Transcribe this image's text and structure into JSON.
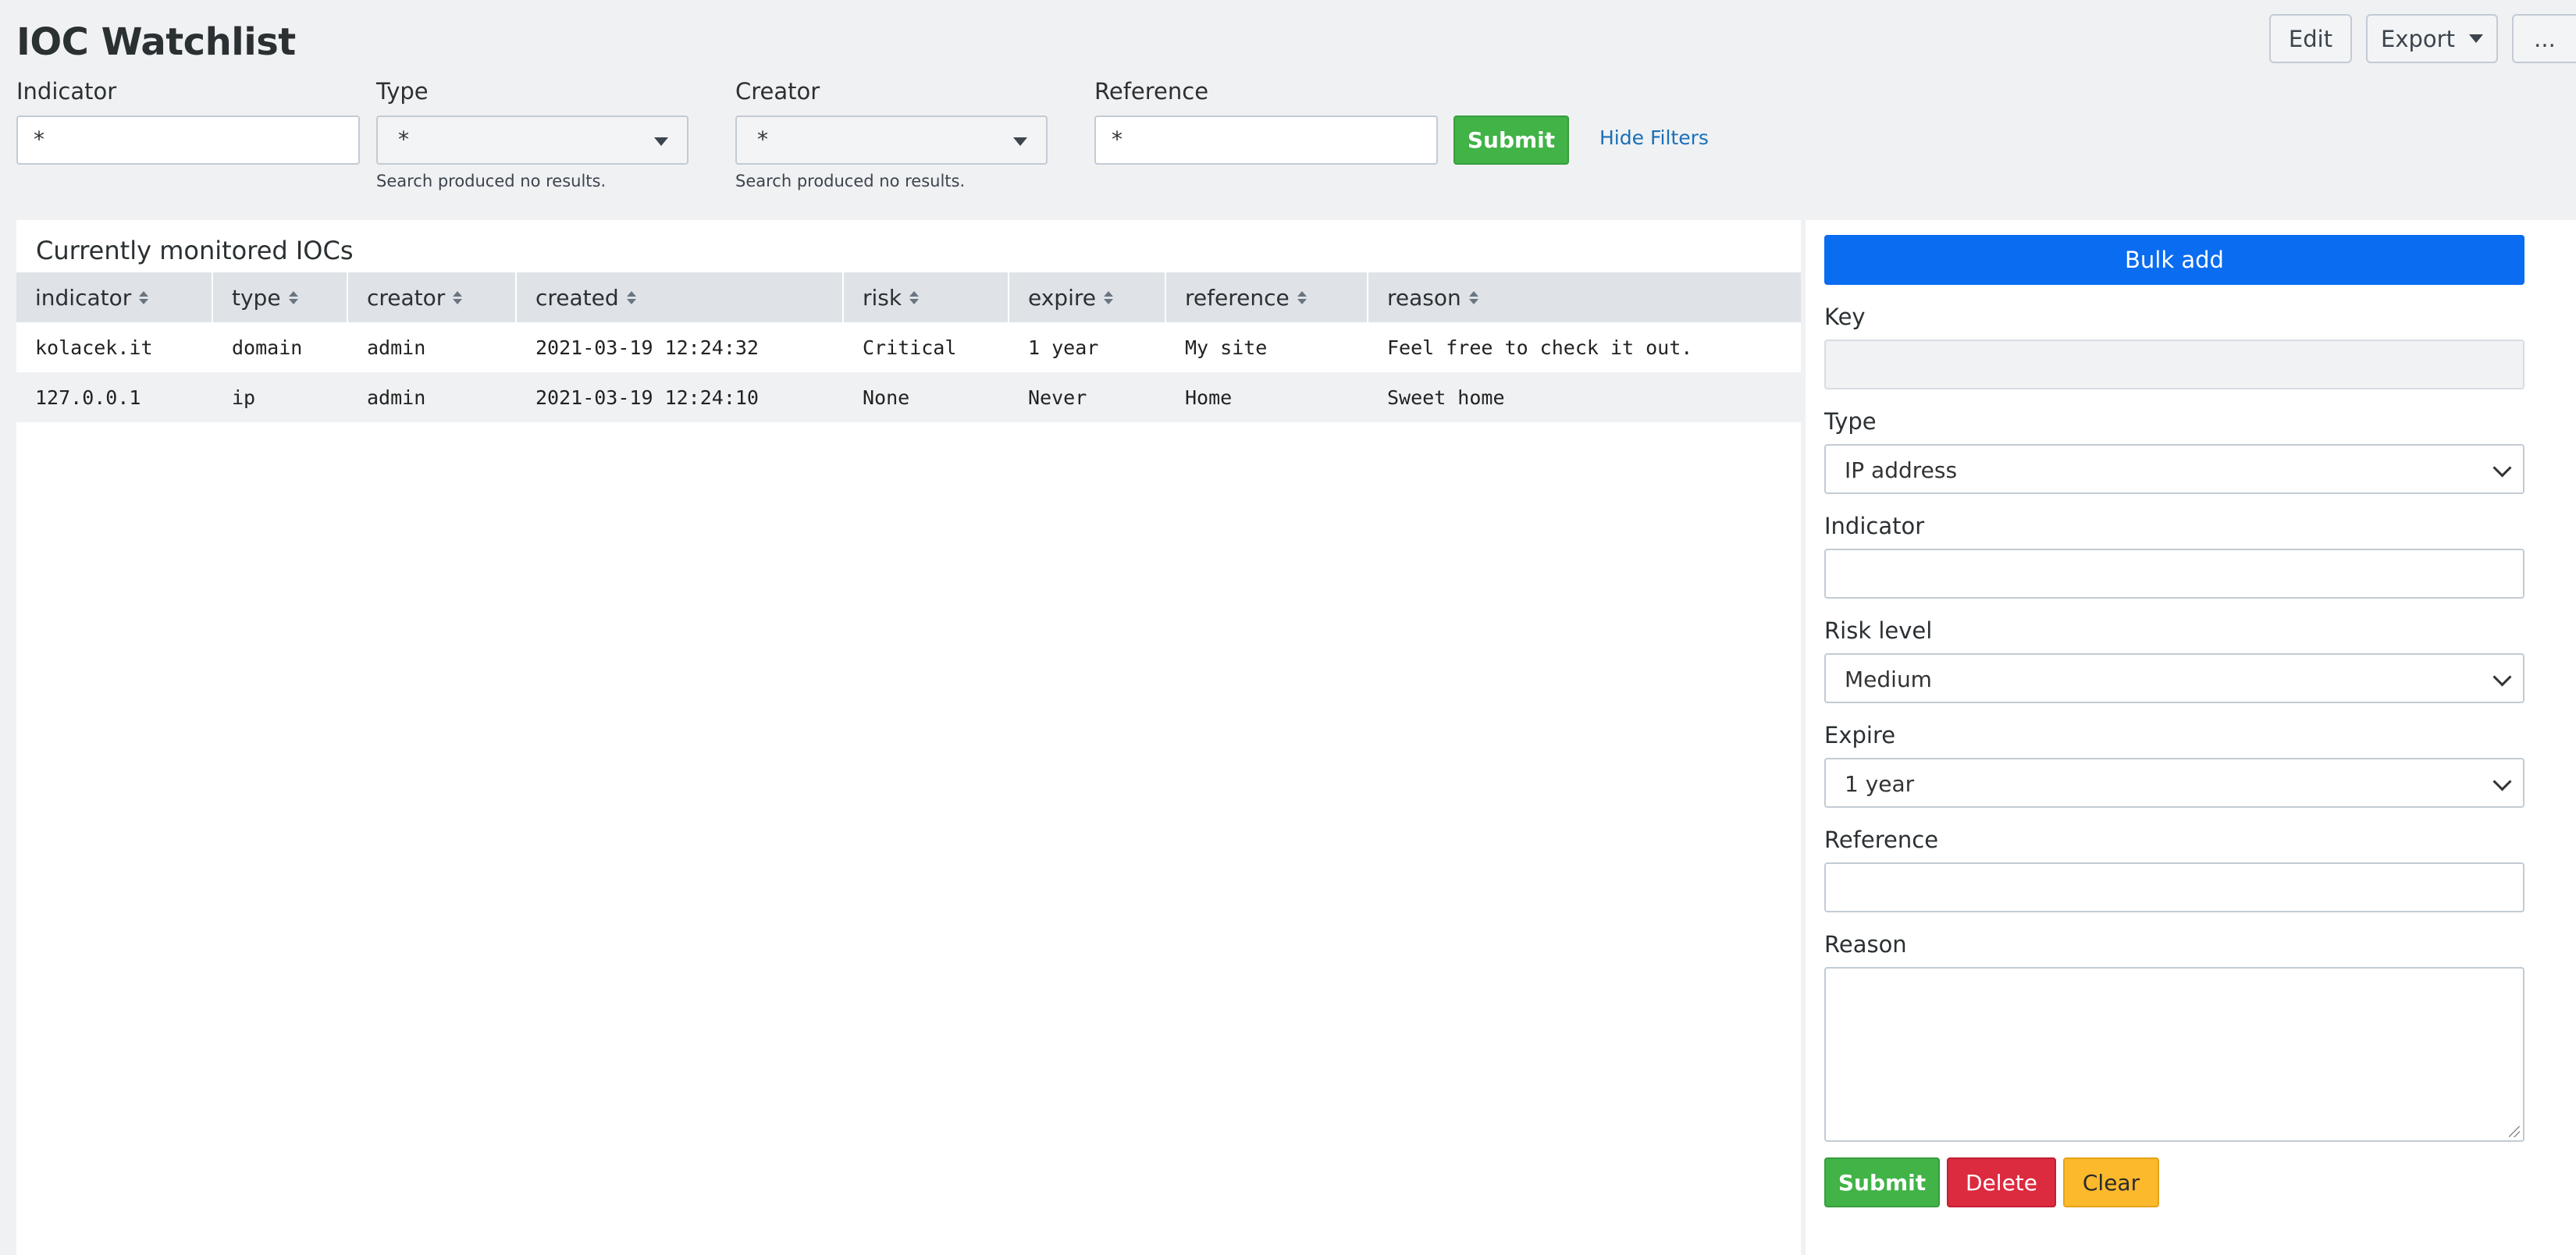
{
  "header": {
    "title": "IOC Watchlist",
    "buttons": {
      "edit": "Edit",
      "export": "Export",
      "more": "..."
    }
  },
  "filters": {
    "indicator": {
      "label": "Indicator",
      "value": "*"
    },
    "type": {
      "label": "Type",
      "value": "*",
      "hint": "Search produced no results."
    },
    "creator": {
      "label": "Creator",
      "value": "*",
      "hint": "Search produced no results."
    },
    "reference": {
      "label": "Reference",
      "value": "*"
    },
    "submit": "Submit",
    "hide_filters": "Hide Filters"
  },
  "table": {
    "title": "Currently monitored IOCs",
    "columns": [
      "indicator",
      "type",
      "creator",
      "created",
      "risk",
      "expire",
      "reference",
      "reason"
    ],
    "rows": [
      [
        "kolacek.it",
        "domain",
        "admin",
        "2021-03-19 12:24:32",
        "Critical",
        "1 year",
        "My site",
        "Feel free to check it out."
      ],
      [
        "127.0.0.1",
        "ip",
        "admin",
        "2021-03-19 12:24:10",
        "None",
        "Never",
        "Home",
        "Sweet home"
      ]
    ]
  },
  "form": {
    "bulk_add": "Bulk add",
    "key": {
      "label": "Key",
      "value": ""
    },
    "type": {
      "label": "Type",
      "value": "IP address"
    },
    "indicator": {
      "label": "Indicator",
      "value": ""
    },
    "risk": {
      "label": "Risk level",
      "value": "Medium"
    },
    "expire": {
      "label": "Expire",
      "value": "1 year"
    },
    "reference": {
      "label": "Reference",
      "value": ""
    },
    "reason": {
      "label": "Reason",
      "value": ""
    },
    "buttons": {
      "submit": "Submit",
      "delete": "Delete",
      "clear": "Clear"
    }
  },
  "colors": {
    "primary": "#0a6cf0",
    "success": "#41b347",
    "danger": "#dc2a3f",
    "warning": "#fdb92c"
  }
}
